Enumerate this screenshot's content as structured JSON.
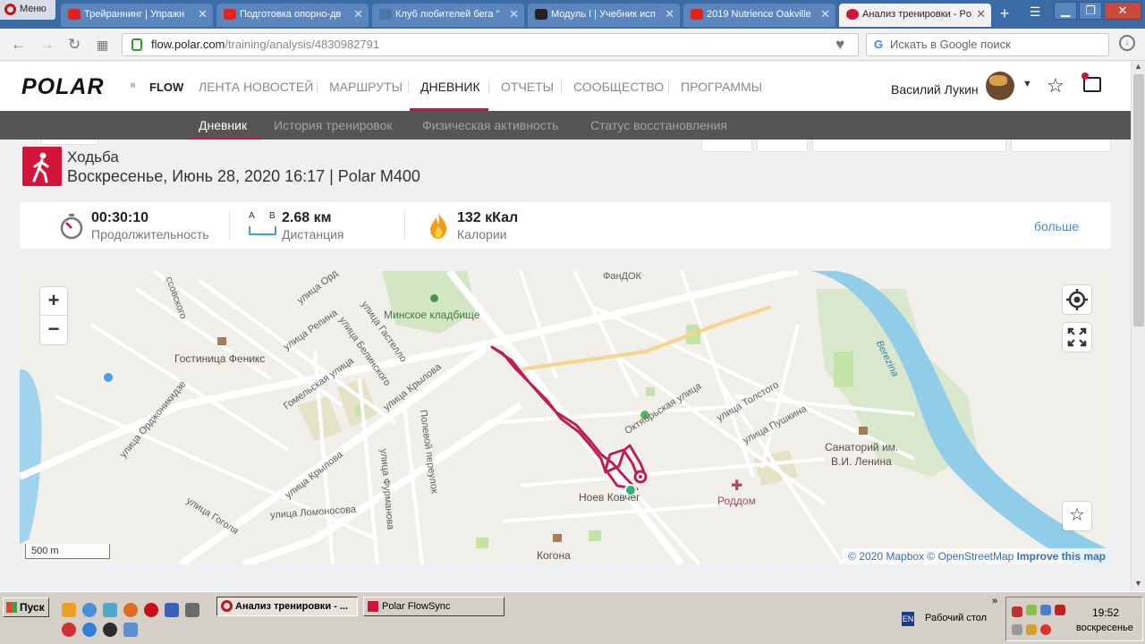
{
  "browser": {
    "menu_label": "Меню",
    "tabs": [
      {
        "title": "Трейраннинг | Упражн",
        "icon": "youtube-icon",
        "color": "#e62117"
      },
      {
        "title": "Подготовка опорно-дв",
        "icon": "youtube-icon",
        "color": "#e62117"
      },
      {
        "title": "Клуб любителей бега \"",
        "icon": "vk-icon",
        "color": "#4a76a8"
      },
      {
        "title": "Модуль I | Учебник исп",
        "icon": "document-icon",
        "color": "#222222"
      },
      {
        "title": "2019 Nutrience Oakville",
        "icon": "youtube-icon",
        "color": "#e62117"
      },
      {
        "title": "Анализ тренировки - Po",
        "icon": "polar-icon",
        "color": "#d2143a"
      }
    ],
    "url_host": "flow.polar.com",
    "url_path": "/training/analysis/4830982791",
    "search_placeholder": "Искать в Google поиск"
  },
  "site": {
    "logo": "POLAR",
    "logo_mark": "®",
    "flow": "FLOW",
    "nav": [
      "ЛЕНТА НОВОСТЕЙ",
      "МАРШРУТЫ",
      "ДНЕВНИК",
      "ОТЧЕТЫ",
      "СООБЩЕСТВО",
      "ПРОГРАММЫ"
    ],
    "active_nav": "ДНЕВНИК",
    "user_name": "Василий Лукин",
    "subnav": [
      "Дневник",
      "История тренировок",
      "Физическая активность",
      "Статус восстановления"
    ],
    "active_subnav": "Дневник",
    "accent_color": "#d2143a"
  },
  "activity": {
    "sport": "Ходьба",
    "date_line": "Воскресенье, Июнь 28, 2020 16:17 | Polar M400"
  },
  "stats": {
    "duration_value": "00:30:10",
    "duration_label": "Продолжительность",
    "distance_value": "2.68 км",
    "distance_label": "Дистанция",
    "distance_icon_a": "A",
    "distance_icon_b": "B",
    "calories_value": "132 кКал",
    "calories_label": "Калории",
    "more_link": "больше"
  },
  "map": {
    "zoom_in": "+",
    "zoom_out": "−",
    "labels": {
      "fandok": "ФанДОК",
      "cemetery": "Минское кладбище",
      "hotel": "Гостиница Феникс",
      "noev": "Ноев Ковчег",
      "roddom": "Роддом",
      "sanatorium_1": "Санаторий им.",
      "sanatorium_2": "В.И. Ленина",
      "kogona": "Когона",
      "berezina": "Berezina",
      "street_ordzh": "улица Орджоникидзе",
      "street_repina": "улица Репина",
      "street_krylova": "улица Крылова",
      "street_krylova2": "улица Крылова",
      "street_gogolya": "улица Гоголя",
      "street_lomonosova": "улица Ломоносова",
      "street_furmanova": "улица Фурманова",
      "street_polevoy": "Полевой переулок",
      "street_gomel": "Гомельская улица",
      "street_belinskogo": "улица Белинского",
      "street_gastello": "улица Гастелло",
      "street_oktyabr": "Октябрьская улица",
      "street_tolstogo": "улица Толстого",
      "street_pushkina": "улица Пушкина",
      "street_ord_top": "улица Орд",
      "street_ssovskogo": "ссовского"
    },
    "scale": "500 m",
    "attribution_mapbox": "© 2020 Mapbox",
    "attribution_osm": "© OpenStreetMap",
    "attribution_improve": "Improve this map",
    "route_color": "#c01f4f"
  },
  "taskbar": {
    "start": "Пуск",
    "tasks": [
      "Анализ тренировки - ...",
      "Polar FlowSync"
    ],
    "lang": "EN",
    "desktop": "Рабочий стол",
    "time": "19:52",
    "day": "воскресенье"
  }
}
